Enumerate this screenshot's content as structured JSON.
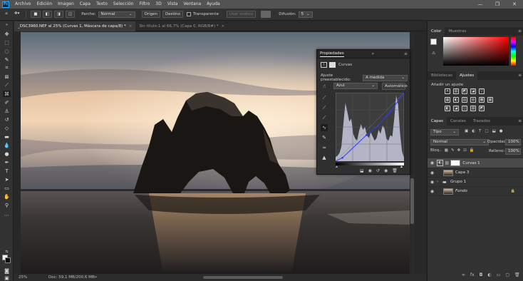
{
  "menubar": {
    "app_logo": "Ps",
    "items": [
      "Archivo",
      "Edición",
      "Imagen",
      "Capa",
      "Texto",
      "Selección",
      "Filtro",
      "3D",
      "Vista",
      "Ventana",
      "Ayuda"
    ],
    "window_controls": [
      "—",
      "❐",
      "✕"
    ]
  },
  "options_bar": {
    "parche_label": "Parche:",
    "parche_value": "Normal",
    "origen": "Origen",
    "destino": "Destino",
    "transparente": "Transparente",
    "usar_motivo": "Usar motivo",
    "difusion_label": "Difusión:",
    "difusion_value": "5"
  },
  "doc_tabs": [
    {
      "label": "_DSC3960.NEF al 25% (Curvas 1, Máscara de capa/8) *",
      "close": "×"
    },
    {
      "label": "Sin título-1 al 66,7% (Capa 0, RGB/8#) *",
      "close": "×"
    }
  ],
  "status_bar": {
    "zoom": "25%",
    "doc_info": "Doc: 59,1 MB/200,6 MB",
    "arrow": ">"
  },
  "properties": {
    "title": "Propiedades",
    "collapse": "»",
    "menu": "≡",
    "subtitle": "Curvas",
    "preset_label": "Ajuste preestablecido:",
    "preset_value": "A medida",
    "channel_value": "Azul",
    "auto_button": "Automático",
    "histogram": [
      0.06,
      0.08,
      0.12,
      0.22,
      0.55,
      0.85,
      0.72,
      0.58,
      0.62,
      0.4,
      0.33,
      0.3,
      0.44,
      0.54,
      0.46,
      0.5,
      0.38,
      0.34,
      0.42,
      0.36,
      0.3,
      0.34,
      0.46,
      0.4,
      0.52,
      0.48,
      0.33,
      0.3,
      0.38,
      0.36,
      0.62,
      0.96,
      0.82,
      0.4,
      0.14,
      0.05
    ],
    "curve_points": [
      [
        0,
        0
      ],
      [
        0.1,
        0.05
      ],
      [
        0.45,
        0.38
      ],
      [
        0.62,
        0.52
      ],
      [
        0.8,
        0.72
      ],
      [
        1,
        1
      ]
    ]
  },
  "color_panel": {
    "tabs": [
      "Color",
      "Muestras"
    ],
    "foreground": "#f5f5f5",
    "background": "#0a0a0a"
  },
  "adjustments_panel": {
    "tabs": [
      "Bibliotecas",
      "Ajustes"
    ],
    "add_label": "Añadir un ajuste",
    "row1": [
      "☀",
      "▥",
      "◩",
      "◪",
      "▽"
    ],
    "row2": [
      "▦",
      "◐",
      "▤",
      "◍",
      "▩",
      "▦"
    ],
    "row3": [
      "◧",
      "◪",
      "◫",
      "▨",
      "◩"
    ]
  },
  "layers_panel": {
    "tabs": [
      "Capas",
      "Canales",
      "Trazados"
    ],
    "filter_value": "Tipo",
    "blend_mode": "Normal",
    "opacity_label": "Opacidad:",
    "opacity_value": "100%",
    "lock_label": "Bloq.:",
    "fill_label": "Relleno:",
    "fill_value": "100%",
    "layers": [
      {
        "name": "Curvas 1",
        "selected": true
      },
      {
        "name": "Capa 3",
        "selected": false
      },
      {
        "name": "Grupo 1",
        "selected": false
      },
      {
        "name": "Fondo",
        "selected": false
      }
    ],
    "footer_buttons": [
      "∞",
      "fx",
      "◘",
      "◐",
      "▭",
      "▢",
      "🗑"
    ]
  }
}
